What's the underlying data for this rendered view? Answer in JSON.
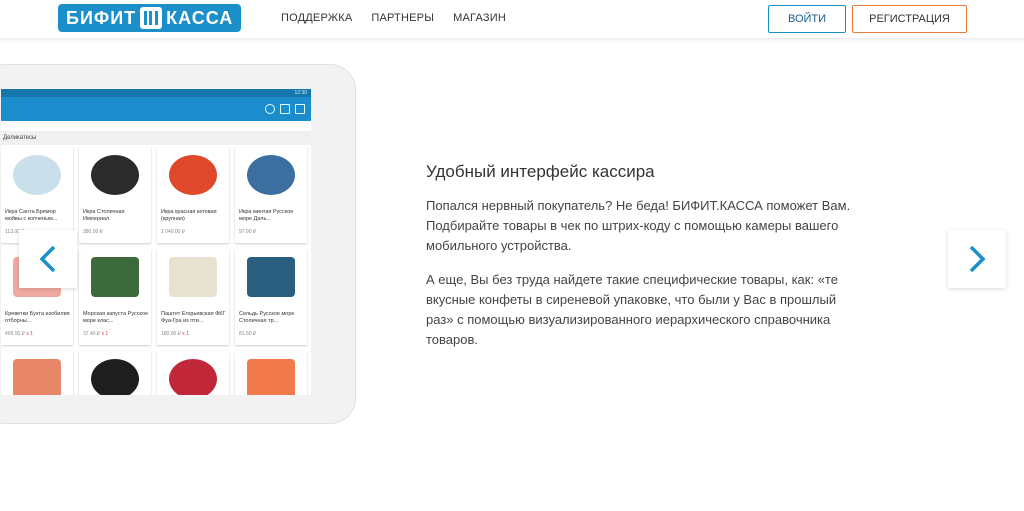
{
  "header": {
    "logo_left": "БИФИТ",
    "logo_right": "КАССА",
    "nav": [
      "ПОДДЕРЖКА",
      "ПАРТНЕРЫ",
      "МАГАЗИН"
    ],
    "login_label": "ВОЙТИ",
    "register_label": "РЕГИСТРАЦИЯ"
  },
  "tablet": {
    "status_time": "12:30",
    "category": "Деликатесы",
    "products": [
      {
        "name": "Икра Санта Бремор мойвы с копченым...",
        "price": "113.00 ₽",
        "qty": ""
      },
      {
        "name": "Икра Столичная Империал",
        "price": "380.00 ₽",
        "qty": ""
      },
      {
        "name": "Икра красная кетовая (крупная)",
        "price": "2 040.00 ₽",
        "qty": ""
      },
      {
        "name": "Икра минтая Русское море Даль...",
        "price": "97.90 ₽",
        "qty": ""
      },
      {
        "name": "Креветки Бухта изобилия отборны...",
        "price": "499.00 ₽",
        "qty": "x 1"
      },
      {
        "name": "Морская капуста Русское море клас...",
        "price": "37.40 ₽",
        "qty": "x 1"
      },
      {
        "name": "Паштет Егорьевская ФКГ Фуа-Гра из пти...",
        "price": "180.00 ₽",
        "qty": "x 1"
      },
      {
        "name": "Сельдь Русское море Столичная тр...",
        "price": "81.60 ₽",
        "qty": ""
      },
      {
        "name": "",
        "price": "",
        "qty": ""
      },
      {
        "name": "",
        "price": "",
        "qty": ""
      },
      {
        "name": "",
        "price": "",
        "qty": ""
      },
      {
        "name": "",
        "price": "",
        "qty": ""
      }
    ]
  },
  "content": {
    "title": "Удобный интерфейс кассира",
    "paragraph1": "Попался нервный покупатель? Не беда! БИФИТ.КАССА поможет Вам. Подбирайте товары в чек по штрих-коду с помощью камеры вашего мобильного устройства.",
    "paragraph2": "А еще, Вы без труда найдете такие специфические товары, как: «те вкусные конфеты в сиреневой упаковке, что были у Вас в прошлый раз» с помощью визуализированного иерархического справочника товаров."
  },
  "colors": {
    "brand_blue": "#1a8fc9",
    "accent_orange": "#e87a3c"
  },
  "icons": {
    "prev": "chevron-left-icon",
    "next": "chevron-right-icon",
    "search": "search-icon",
    "scan": "barcode-scan-icon",
    "delete": "trash-icon"
  }
}
